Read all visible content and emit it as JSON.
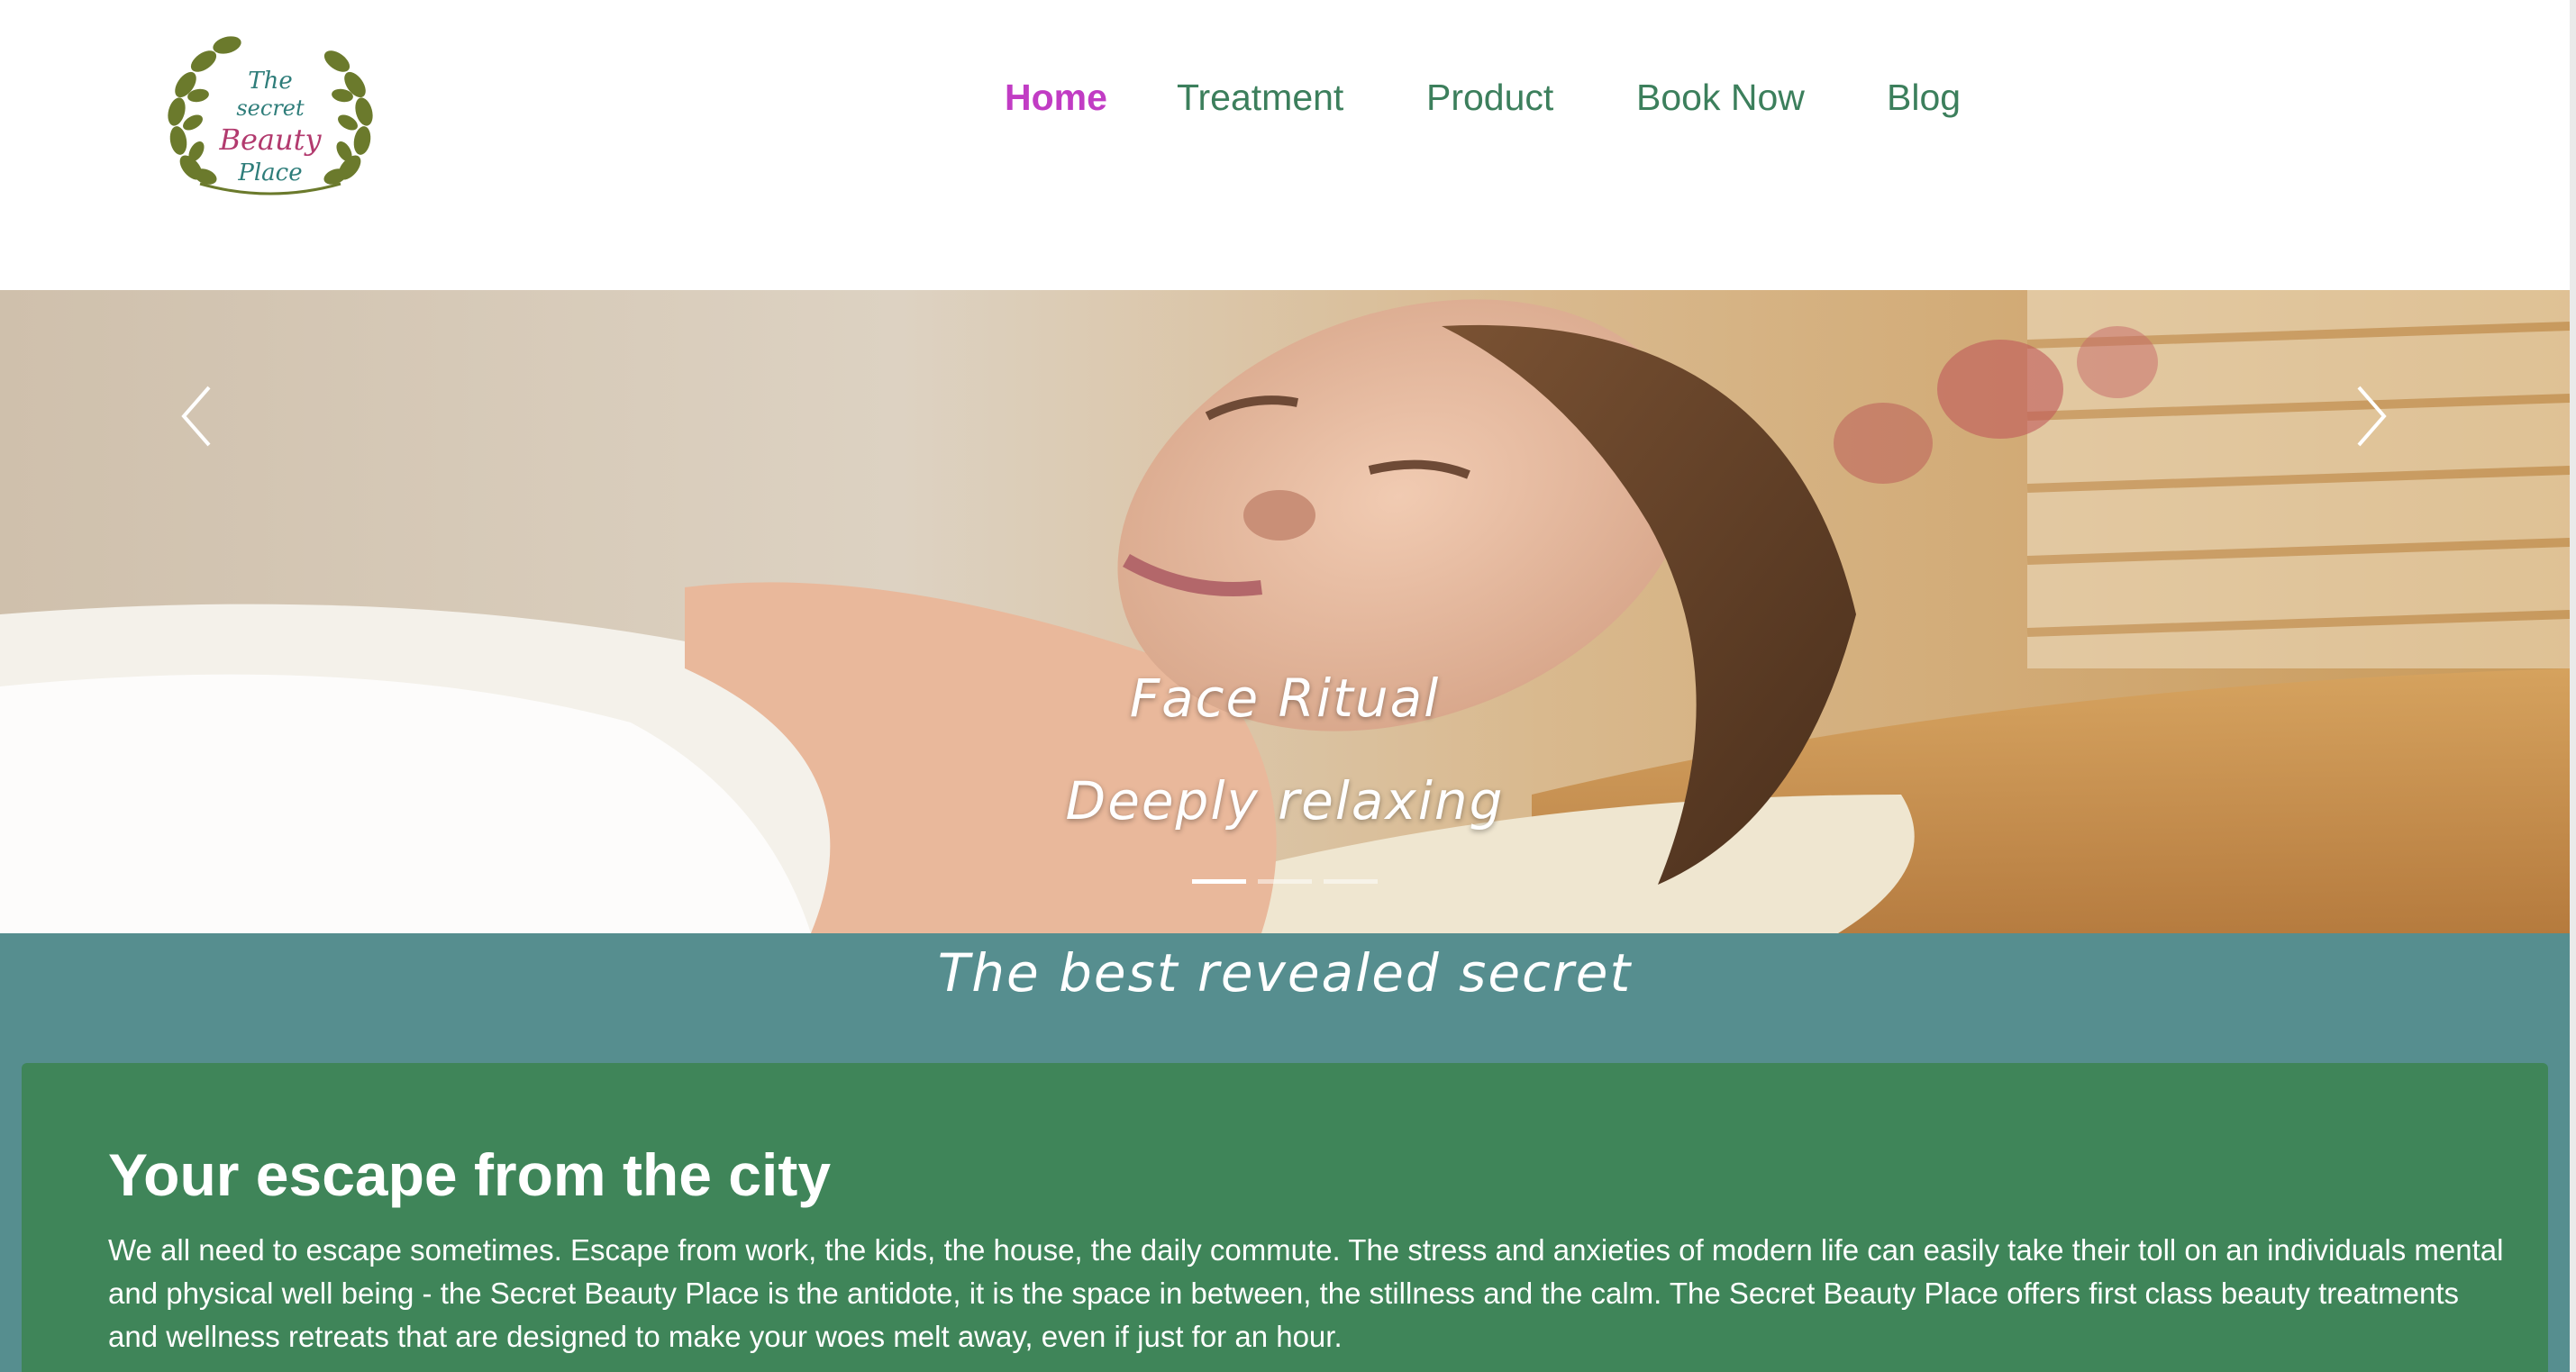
{
  "site": {
    "logo": {
      "line1": "The",
      "line2": "secret",
      "line3": "Beauty",
      "line4": "Place"
    },
    "nav": [
      {
        "label": "Home",
        "active": true
      },
      {
        "label": "Treatment",
        "active": false
      },
      {
        "label": "Product",
        "active": false
      },
      {
        "label": "Book Now",
        "active": false
      },
      {
        "label": "Blog",
        "active": false
      }
    ]
  },
  "hero": {
    "caption_title": "Face Ritual",
    "caption_subtitle": "Deeply relaxing",
    "slide_count": 3,
    "active_slide": 1,
    "prev_icon": "chevron-left-icon",
    "next_icon": "chevron-right-icon"
  },
  "tagline": "The best revealed secret",
  "intro": {
    "title": "Your escape from the city",
    "body": "We all need to escape sometimes. Escape from work, the kids, the house, the daily commute. The stress and anxieties of modern life can easily take their toll on an individuals mental and physical well being - the Secret Beauty Place is the antidote, it is the space in between, the stillness and the calm. The Secret Beauty Place offers first class beauty treatments and wellness retreats that are designed to make your woes melt away, even if just for an hour."
  },
  "colors": {
    "nav_active": "#c13cc4",
    "nav_link": "#3c7f5c",
    "band": "#568e8f",
    "card": "#3f8559",
    "logo_leaf": "#6b7a2c",
    "logo_text_teal": "#2e7d7a",
    "logo_text_pink": "#b23a6e"
  }
}
